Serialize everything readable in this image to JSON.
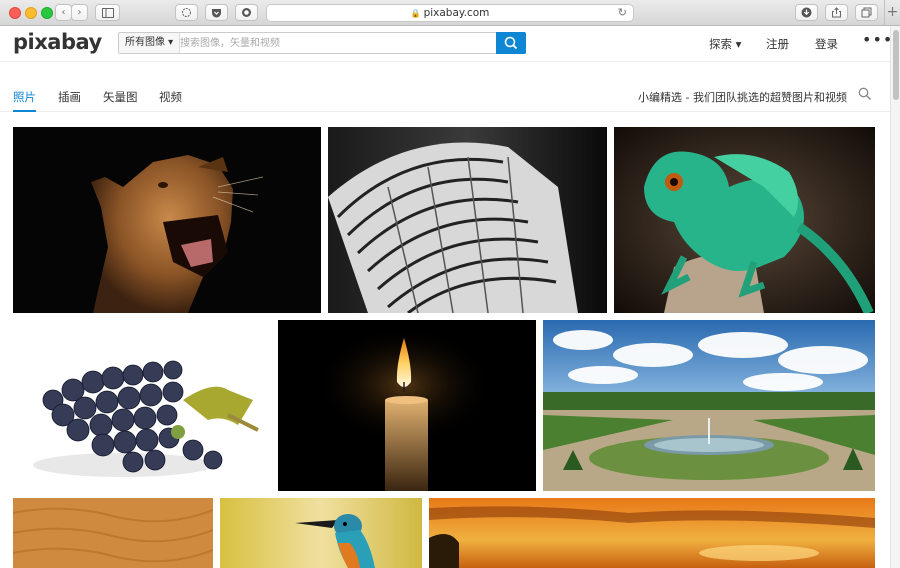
{
  "browser": {
    "url": "pixabay.com",
    "icons": [
      "back-icon",
      "forward-icon",
      "sidebar-icon",
      "extension-icon",
      "pocket-icon",
      "screenshot-icon",
      "download-icon",
      "share-icon",
      "tabs-icon",
      "new-tab-icon"
    ]
  },
  "header": {
    "logo": "pixabay",
    "search_type": "所有图像 ▾",
    "search_placeholder": "搜索图像，矢量和视频",
    "explore": "探索 ▾",
    "register": "注册",
    "login": "登录",
    "more": "•••"
  },
  "tabs": {
    "items": [
      "照片",
      "插画",
      "矢量图",
      "视频"
    ],
    "active": "照片",
    "editor_text": "小编精选 - 我们团队挑选的超赞图片和视频"
  },
  "colors": {
    "accent": "#0e86d4",
    "text": "#333333"
  },
  "images": [
    {
      "name": "lioness-photo",
      "subject": "lioness"
    },
    {
      "name": "building-photo",
      "subject": "skyscraper"
    },
    {
      "name": "lizard-photo",
      "subject": "lizard"
    },
    {
      "name": "grapes-photo",
      "subject": "grapes"
    },
    {
      "name": "candle-photo",
      "subject": "candle"
    },
    {
      "name": "garden-photo",
      "subject": "fountain garden"
    },
    {
      "name": "sand-dunes-photo",
      "subject": "sand dunes"
    },
    {
      "name": "kingfisher-photo",
      "subject": "kingfisher"
    },
    {
      "name": "sunset-photo",
      "subject": "sunset"
    }
  ]
}
